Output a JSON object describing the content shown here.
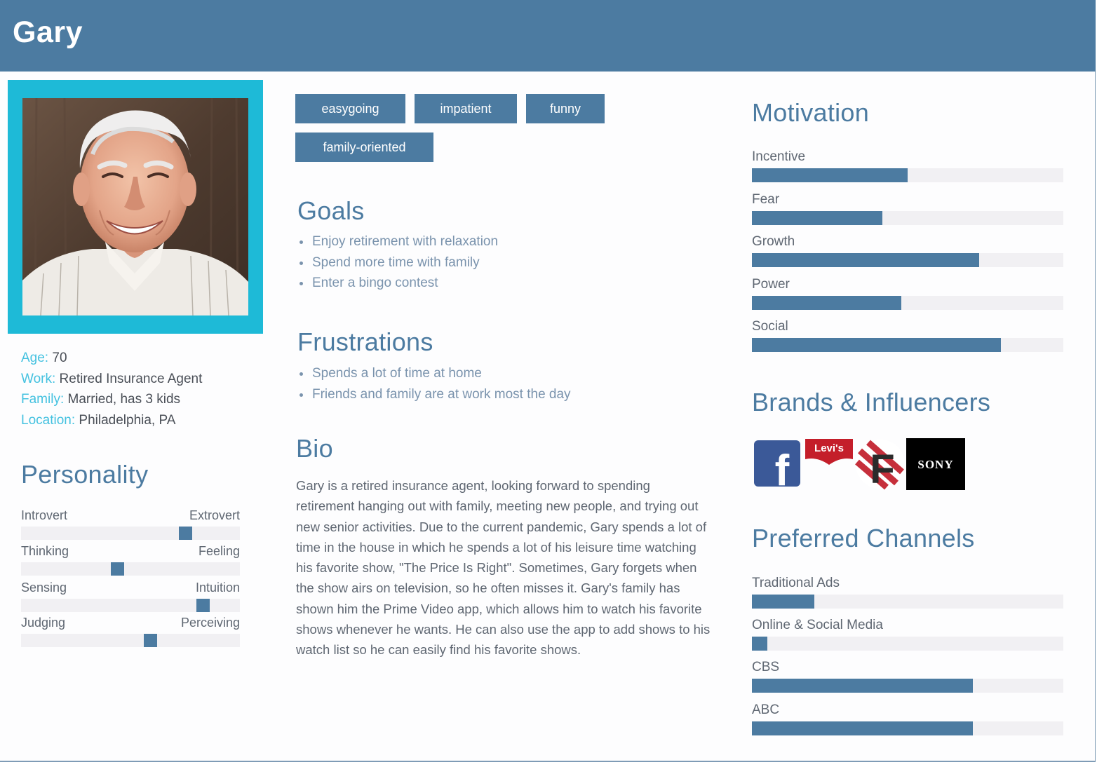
{
  "name": "Gary",
  "facts": [
    {
      "key": "Age:",
      "value": "70"
    },
    {
      "key": "Work:",
      "value": "Retired Insurance Agent"
    },
    {
      "key": "Family:",
      "value": "Married, has 3 kids"
    },
    {
      "key": "Location:",
      "value": "Philadelphia, PA"
    }
  ],
  "personality": {
    "title": "Personality",
    "traits": [
      {
        "left": "Introvert",
        "right": "Extrovert",
        "level": 0.75
      },
      {
        "left": "Thinking",
        "right": "Feeling",
        "level": 0.44
      },
      {
        "left": "Sensing",
        "right": "Intuition",
        "level": 0.83
      },
      {
        "left": "Judging",
        "right": "Perceiving",
        "level": 0.59
      }
    ]
  },
  "tags": [
    "easygoing",
    "impatient",
    "funny",
    "family-oriented"
  ],
  "goals": {
    "title": "Goals",
    "items": [
      "Enjoy retirement with relaxation",
      "Spend more time with family",
      "Enter a bingo contest"
    ]
  },
  "frustrations": {
    "title": "Frustrations",
    "items": [
      "Spends a lot of time at home",
      "Friends and family are at work most the day"
    ]
  },
  "bio": {
    "title": "Bio",
    "text": "Gary is a retired insurance agent, looking forward to spending retirement hanging out with family, meeting new people, and trying out new senior activities. Due to the current pandemic, Gary spends a lot of time in the house in which he spends a lot of his leisure time watching his favorite show, \"The Price Is Right\". Sometimes, Gary forgets when the show airs on television, so he often misses it. Gary's family has shown him the Prime Video app, which allows him to watch his favorite shows whenever he wants. He can also use the app to add shows to his watch list so he can easily find his favorite shows."
  },
  "motivation": {
    "title": "Motivation",
    "items": [
      {
        "label": "Incentive",
        "value": 0.5
      },
      {
        "label": "Fear",
        "value": 0.42
      },
      {
        "label": "Growth",
        "value": 0.73
      },
      {
        "label": "Power",
        "value": 0.48
      },
      {
        "label": "Social",
        "value": 0.8
      }
    ]
  },
  "brands": {
    "title": "Brands & Influencers",
    "logos": [
      {
        "name": "facebook-logo",
        "text": "f"
      },
      {
        "name": "levis-logo",
        "text": "Levi's"
      },
      {
        "name": "f-brand-logo",
        "text": "F"
      },
      {
        "name": "sony-logo",
        "text": "SONY"
      }
    ]
  },
  "channels": {
    "title": "Preferred Channels",
    "items": [
      {
        "label": "Traditional Ads",
        "value": 0.2
      },
      {
        "label": "Online & Social Media",
        "value": 0.05
      },
      {
        "label": "CBS",
        "value": 0.71
      },
      {
        "label": "ABC",
        "value": 0.71
      }
    ]
  },
  "colors": {
    "primary": "#4c7ba1",
    "accent": "#1ebad7",
    "label_accent": "#45c2e0",
    "track": "#f1f0f3"
  }
}
